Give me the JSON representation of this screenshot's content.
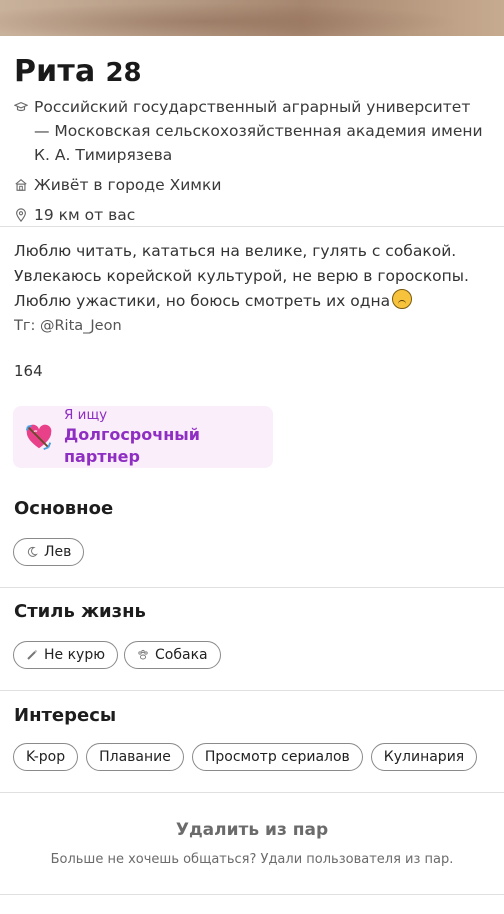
{
  "profile": {
    "name": "Рита",
    "age": "28",
    "university": "Российский государственный аграрный университет — Московская сельскохозяйственная академия имени К. А. Тимирязева",
    "city": "Живёт в городе Химки",
    "distance": "19 км от вас"
  },
  "bio": {
    "line1": "Люблю читать, кататься на велике, гулять с собакой.",
    "line2": "Увлекаюсь корейской культурой, не верю в гороскопы.",
    "line3": "Люблю ужастики, но боюсь смотреть их одна",
    "telegram": "Тг: @Rita_Jeon"
  },
  "height": "164",
  "looking_for": {
    "label": "Я ищу",
    "value": "Долгосрочный партнер"
  },
  "basics": {
    "title": "Основное",
    "chips": [
      {
        "label": "Лев",
        "icon": "moon-icon"
      }
    ]
  },
  "lifestyle": {
    "title": "Стиль жизнь",
    "chips": [
      {
        "label": "Не курю",
        "icon": "cigarette-icon"
      },
      {
        "label": "Собака",
        "icon": "paw-icon"
      }
    ]
  },
  "interests": {
    "title": "Интересы",
    "chips": [
      {
        "label": "K-pop"
      },
      {
        "label": "Плавание"
      },
      {
        "label": "Просмотр сериалов"
      },
      {
        "label": "Кулинария"
      }
    ]
  },
  "unmatch": {
    "title": "Удалить из пар",
    "subtitle": "Больше не хочешь общаться? Удали пользователя из пар."
  },
  "colors": {
    "accent_purple": "#8e2ec2",
    "looking_card_bg": "#fbeefb"
  }
}
